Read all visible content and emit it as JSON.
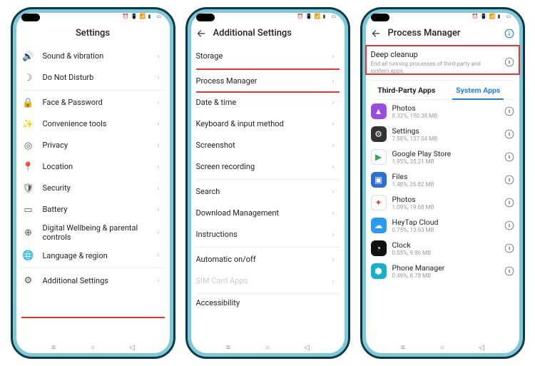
{
  "screen1": {
    "title": "Settings",
    "items": [
      {
        "label": "Sound & vibration"
      },
      {
        "label": "Do Not Disturb"
      },
      {
        "label": "Face & Password"
      },
      {
        "label": "Convenience tools"
      },
      {
        "label": "Privacy"
      },
      {
        "label": "Location"
      },
      {
        "label": "Security"
      },
      {
        "label": "Battery"
      },
      {
        "label": "Digital Wellbeing & parental controls"
      },
      {
        "label": "Language & region"
      },
      {
        "label": "Additional Settings"
      }
    ]
  },
  "screen2": {
    "title": "Additional Settings",
    "items": [
      {
        "label": "Storage"
      },
      {
        "label": "Process Manager"
      },
      {
        "label": "Date & time"
      },
      {
        "label": "Keyboard & input method"
      },
      {
        "label": "Screenshot"
      },
      {
        "label": "Screen recording"
      },
      {
        "label": "Search"
      },
      {
        "label": "Download Management"
      },
      {
        "label": "Instructions"
      },
      {
        "label": "Automatic on/off"
      },
      {
        "label": "SIM Card Apps"
      },
      {
        "label": "Accessibility"
      }
    ]
  },
  "screen3": {
    "title": "Process Manager",
    "deep_title": "Deep cleanup",
    "deep_sub": "End all running processes of third-party and system apps.",
    "tab_third": "Third-Party Apps",
    "tab_system": "System Apps",
    "apps": [
      {
        "name": "Photos",
        "meta": "8.32%, 150.38 MB",
        "bg": "#9b4de0",
        "glyph": "▲"
      },
      {
        "name": "Settings",
        "meta": "7.58%, 137.04 MB",
        "bg": "#333",
        "glyph": "⚙"
      },
      {
        "name": "Google Play Store",
        "meta": "1.95%, 35.21 MB",
        "bg": "#fff",
        "glyph": "▶",
        "fg": "#34a853",
        "border": "1"
      },
      {
        "name": "Files",
        "meta": "1.48%, 26.82 MB",
        "bg": "#2a6fd6",
        "glyph": "▣"
      },
      {
        "name": "Photos",
        "meta": "1.09%, 19.68 MB",
        "bg": "#fff",
        "glyph": "✦",
        "fg": "#ea4335",
        "border": "1"
      },
      {
        "name": "HeyTap Cloud",
        "meta": "0.75%, 13.63 MB",
        "bg": "#2a9bf2",
        "glyph": "☁"
      },
      {
        "name": "Clock",
        "meta": "0.55%, 9.86 MB",
        "bg": "#111",
        "glyph": "◔"
      },
      {
        "name": "Phone Manager",
        "meta": "0.49%, 8.78 MB",
        "bg": "#17b1c9",
        "glyph": "⬢"
      }
    ]
  }
}
